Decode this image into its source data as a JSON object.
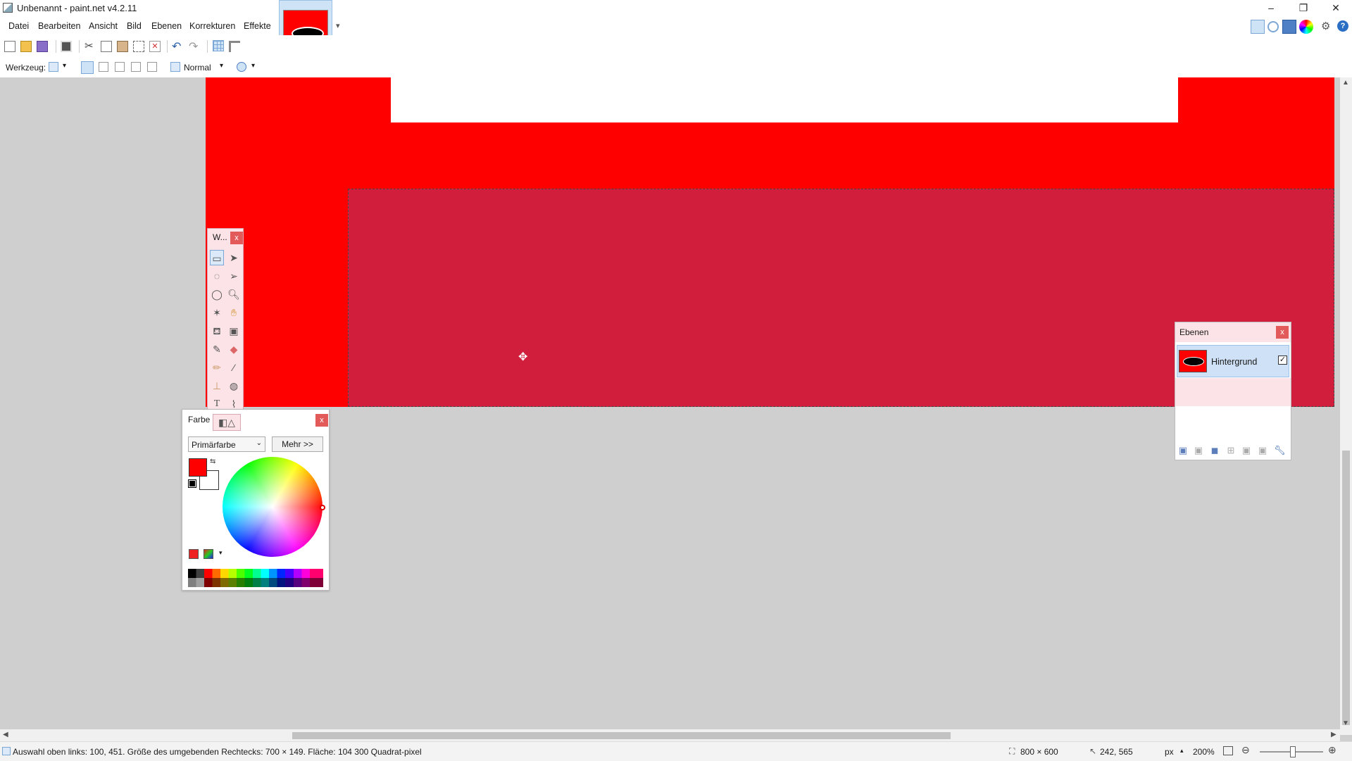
{
  "window": {
    "title": "Unbenannt - paint.net v4.2.11",
    "minimize": "–",
    "maximize": "❐",
    "close": "✕"
  },
  "menu": [
    "Datei",
    "Bearbeiten",
    "Ansicht",
    "Bild",
    "Ebenen",
    "Korrekturen",
    "Effekte"
  ],
  "tab_dropdown": "▾",
  "toolbar2": {
    "tool_label": "Werkzeug:",
    "blend_mode": "Normal"
  },
  "tools_window": {
    "title": "W...",
    "close": "x",
    "tools": [
      "rectangle-select",
      "move-selected",
      "lasso-select",
      "move-selection",
      "ellipse-select",
      "zoom",
      "magic-wand",
      "pan",
      "paint-bucket",
      "gradient",
      "paintbrush",
      "eraser",
      "pencil",
      "color-picker",
      "clone-stamp",
      "recolor",
      "text",
      "line-curve",
      "shapes"
    ]
  },
  "colors_window": {
    "title": "Farbe",
    "close": "x",
    "mode_select": "Primärfarbe",
    "more_button": "Mehr >>",
    "primary_color": "#ff0000",
    "secondary_color": "#ffffff"
  },
  "layers_window": {
    "title": "Ebenen",
    "close": "x",
    "layer_name": "Hintergrund",
    "visible_check": "✓"
  },
  "status": {
    "selection_info": "Auswahl oben links: 100, 451. Größe des umgebenden Rechtecks: 700 × 149. Fläche: 104 300 Quadrat-pixel",
    "image_size": "800 × 600",
    "cursor_position": "242, 565",
    "unit": "px",
    "zoom": "200%"
  },
  "colors": {
    "canvas_red": "#ff0000",
    "selection_fill": "#d11e3c",
    "window_tint": "#fbe3e7"
  }
}
